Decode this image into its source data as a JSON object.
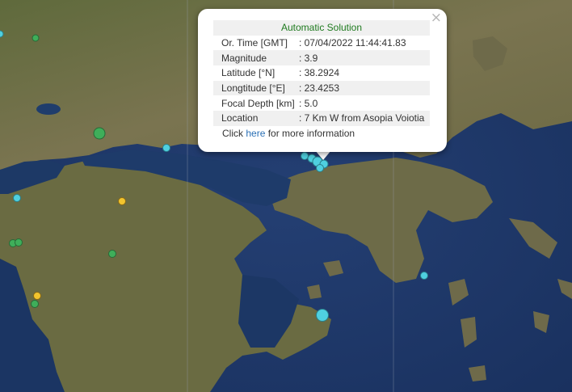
{
  "popup": {
    "close_symbol": "×",
    "title": "Automatic Solution",
    "rows": [
      {
        "label": "Or. Time [GMT]",
        "value": ": 07/04/2022 11:44:41.83"
      },
      {
        "label": "Magnitude",
        "value": ": 3.9"
      },
      {
        "label": "Latitude [°N]",
        "value": ": 38.2924"
      },
      {
        "label": "Longtitude [°E]",
        "value": ": 23.4253"
      },
      {
        "label": "Focal Depth [km]",
        "value": ": 5.0"
      },
      {
        "label": "Location",
        "value": ": 7 Km W from Asopia Voiotia"
      }
    ],
    "more_prefix": "Click",
    "more_link": "here",
    "more_suffix": "for more information"
  },
  "colors": {
    "sea": "#1f3b6e",
    "land": "#6f6a42",
    "marker_cyan": "#4fd0e0",
    "marker_green": "#3fae5a",
    "marker_yellow": "#f2c42e",
    "title_green": "#1f7a1f",
    "link_blue": "#2a6fb5"
  },
  "icons": {
    "close": "close-icon"
  }
}
